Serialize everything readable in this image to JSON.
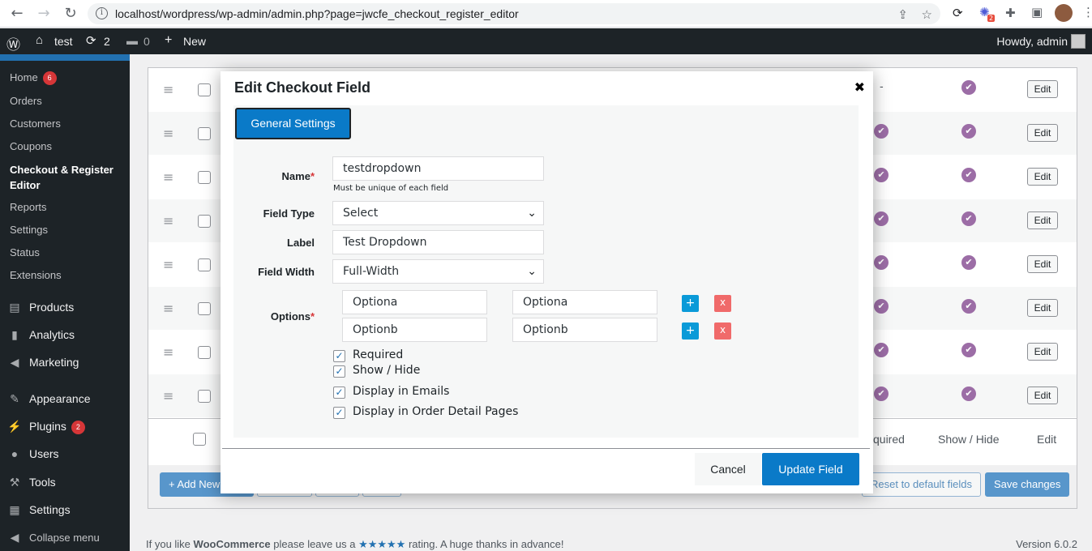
{
  "browser": {
    "url": "localhost/wordpress/wp-admin/admin.php?page=jwcfe_checkout_register_editor",
    "ext_badge": "2"
  },
  "adminbar": {
    "site": "test",
    "updates": "2",
    "comments": "0",
    "new": "New",
    "howdy": "Howdy, admin"
  },
  "sidebar": {
    "sub_items": [
      {
        "label": "Home",
        "badge": "6"
      },
      {
        "label": "Orders"
      },
      {
        "label": "Customers"
      },
      {
        "label": "Coupons"
      },
      {
        "label": "Checkout & Register Editor"
      },
      {
        "label": "Reports"
      },
      {
        "label": "Settings"
      },
      {
        "label": "Status"
      },
      {
        "label": "Extensions"
      }
    ],
    "top_items": [
      {
        "label": "Products",
        "icon": "products-icon"
      },
      {
        "label": "Analytics",
        "icon": "analytics-icon"
      },
      {
        "label": "Marketing",
        "icon": "marketing-icon"
      },
      {
        "label": "Appearance",
        "icon": "appearance-icon"
      },
      {
        "label": "Plugins",
        "icon": "plugins-icon",
        "badge": "2"
      },
      {
        "label": "Users",
        "icon": "users-icon"
      },
      {
        "label": "Tools",
        "icon": "tools-icon"
      },
      {
        "label": "Settings",
        "icon": "settings-icon"
      },
      {
        "label": "Collapse menu",
        "icon": "collapse-icon"
      }
    ]
  },
  "table": {
    "edit_label": "Edit",
    "dash": "-",
    "footer_headers": {
      "required": "quired",
      "show_hide": "Show / Hide",
      "edit": "Edit"
    }
  },
  "bottom_buttons": {
    "add_new": "+ Add New",
    "reset": "Reset to default fields",
    "save": "Save changes"
  },
  "footer": {
    "text_prefix": "If you like ",
    "brand": "WooCommerce",
    "text_mid": " please leave us a ",
    "stars": "★★★★★",
    "text_suffix": " rating. A huge thanks in advance!",
    "version": "Version 6.0.2"
  },
  "modal": {
    "title": "Edit Checkout Field",
    "tab": "General Settings",
    "name_label": "Name",
    "name_value": "testdropdown",
    "name_hint": "Must be unique of each field",
    "type_label": "Field Type",
    "type_value": "Select",
    "label_label": "Label",
    "label_value": "Test Dropdown",
    "width_label": "Field Width",
    "width_value": "Full-Width",
    "options_label": "Options",
    "options": [
      {
        "value": "Optiona",
        "text": "Optiona"
      },
      {
        "value": "Optionb",
        "text": "Optionb"
      }
    ],
    "plus": "+",
    "minus": "x",
    "checkboxes": [
      {
        "label": "Required",
        "checked": true
      },
      {
        "label": "Show / Hide",
        "checked": true
      },
      {
        "label": "Display in Emails",
        "checked": true
      },
      {
        "label": "Display in Order Detail Pages",
        "checked": true
      }
    ],
    "cancel": "Cancel",
    "update": "Update Field"
  }
}
